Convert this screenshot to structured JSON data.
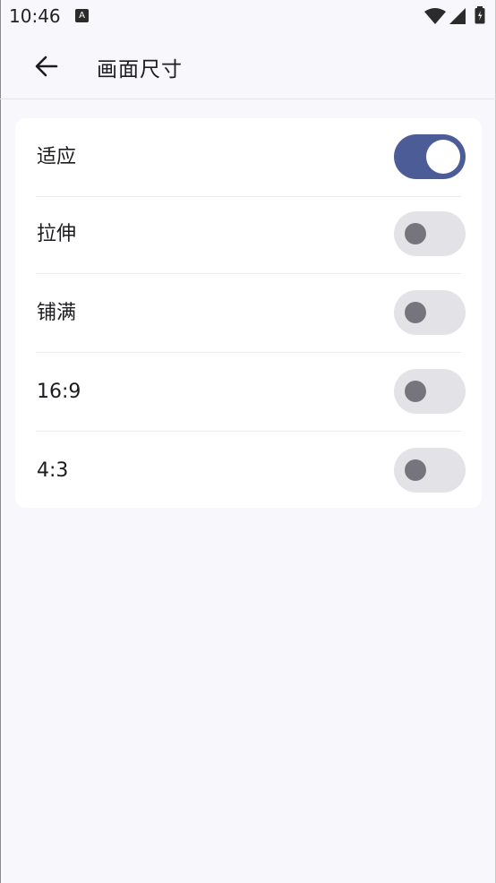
{
  "status_bar": {
    "time": "10:46",
    "notification_glyph": "A",
    "icons": [
      "notification-icon",
      "wifi-icon",
      "signal-icon",
      "battery-icon"
    ]
  },
  "app_bar": {
    "back_icon": "arrow-left-icon",
    "title": "画面尺寸"
  },
  "options": [
    {
      "label": "适应",
      "checked": true
    },
    {
      "label": "拉伸",
      "checked": false
    },
    {
      "label": "铺满",
      "checked": false
    },
    {
      "label": "16:9",
      "checked": false
    },
    {
      "label": "4:3",
      "checked": false
    }
  ],
  "colors": {
    "background": "#f8f7fc",
    "card": "#ffffff",
    "switch_on": "#4c5c97",
    "switch_off_track": "#e3e2e7",
    "switch_off_thumb": "#76757d"
  }
}
